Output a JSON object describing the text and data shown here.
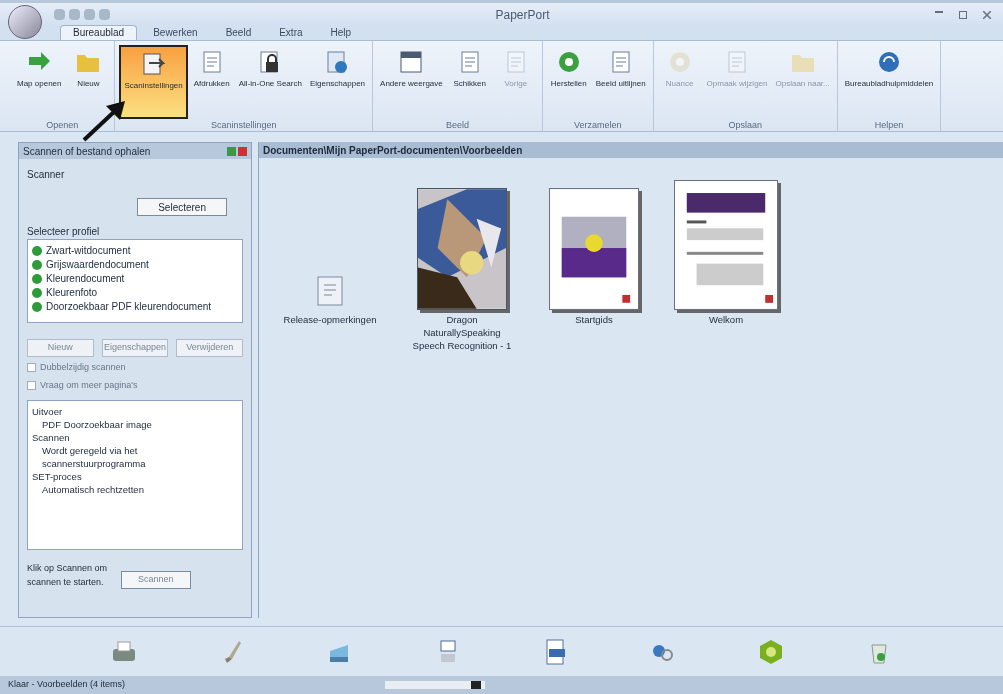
{
  "window": {
    "title": "PaperPort"
  },
  "tabs": [
    {
      "label": "Bureaublad",
      "selected": true
    },
    {
      "label": "Bewerken",
      "selected": false
    },
    {
      "label": "Beeld",
      "selected": false
    },
    {
      "label": "Extra",
      "selected": false
    },
    {
      "label": "Help",
      "selected": false
    }
  ],
  "ribbon_groups": [
    {
      "label": "Openen",
      "buttons": [
        {
          "label": "Map openen",
          "selected": false,
          "disabled": false
        },
        {
          "label": "Nieuw",
          "selected": false,
          "disabled": false
        }
      ]
    },
    {
      "label": "Scaninstellingen",
      "buttons": [
        {
          "label": "Scaninstellingen",
          "selected": true,
          "disabled": false
        },
        {
          "label": "Afdrukken",
          "selected": false,
          "disabled": false
        },
        {
          "label": "All-in-One Search",
          "selected": false,
          "disabled": false
        },
        {
          "label": "Eigenschappen",
          "selected": false,
          "disabled": false
        }
      ]
    },
    {
      "label": "Beeld",
      "buttons": [
        {
          "label": "Andere weergave",
          "selected": false,
          "disabled": false
        },
        {
          "label": "Schikken",
          "selected": false,
          "disabled": false
        },
        {
          "label": "Vorige",
          "selected": false,
          "disabled": true
        }
      ]
    },
    {
      "label": "Verzamelen",
      "buttons": [
        {
          "label": "Herstellen",
          "selected": false,
          "disabled": false
        },
        {
          "label": "Beeld uitlijnen",
          "selected": false,
          "disabled": false
        }
      ]
    },
    {
      "label": "Opslaan",
      "buttons": [
        {
          "label": "Nuance",
          "selected": false,
          "disabled": true
        },
        {
          "label": "Opmaak wijzigen",
          "selected": false,
          "disabled": true
        },
        {
          "label": "Opslaan naar...",
          "selected": false,
          "disabled": true
        }
      ]
    },
    {
      "label": "Helpen",
      "buttons": [
        {
          "label": "Bureaubladhulpmiddelen",
          "selected": false,
          "disabled": false
        }
      ]
    }
  ],
  "left_panel": {
    "title": "Scannen of bestand ophalen",
    "scanner_label": "Scanner",
    "select_button": "Selecteren",
    "profile_label": "Selecteer profiel",
    "profiles": [
      {
        "label": "Zwart-witdocument",
        "selected": false
      },
      {
        "label": "Grijswaardendocument",
        "selected": false
      },
      {
        "label": "Kleurendocument",
        "selected": false
      },
      {
        "label": "Kleurenfoto",
        "selected": false
      },
      {
        "label": "Doorzoekbaar PDF kleurendocument",
        "selected": false
      }
    ],
    "profile_buttons": [
      {
        "label": "Nieuw",
        "disabled": true
      },
      {
        "label": "Eigenschappen",
        "disabled": true
      },
      {
        "label": "Verwijderen",
        "disabled": true
      }
    ],
    "options": [
      {
        "label": "Dubbelzijdig scannen",
        "checked": false,
        "disabled": true
      },
      {
        "label": "Vraag om meer pagina's",
        "checked": false,
        "disabled": true
      }
    ],
    "settings": [
      {
        "label": "Uitvoer",
        "kind": "heading"
      },
      {
        "label": "PDF Doorzoekbaar image",
        "kind": "value"
      },
      {
        "label": "Scannen",
        "kind": "heading"
      },
      {
        "label": "Wordt geregeld via het scannerstuurprogramma",
        "kind": "value"
      },
      {
        "label": "SET-proces",
        "kind": "heading"
      },
      {
        "label": "Automatisch rechtzetten",
        "kind": "value"
      }
    ],
    "hint": "Klik op Scannen om scannen te starten.",
    "scan_button": {
      "label": "Scannen",
      "disabled": true
    }
  },
  "folder": {
    "path": "Documenten\\Mijn PaperPort-documenten\\Voorbeelden",
    "items": [
      {
        "label": "Release-opmerkingen",
        "kind": "file"
      },
      {
        "label": "Dragon NaturallySpeaking Speech Recognition - 1"
      },
      {
        "label": "Startgids",
        "kind": "guide"
      },
      {
        "label": "Welkom",
        "kind": "letter"
      }
    ]
  },
  "status_bar": {
    "text": "Klaar - Voorbeelden (4 items)",
    "zoom": {
      "level": 0.95
    }
  }
}
